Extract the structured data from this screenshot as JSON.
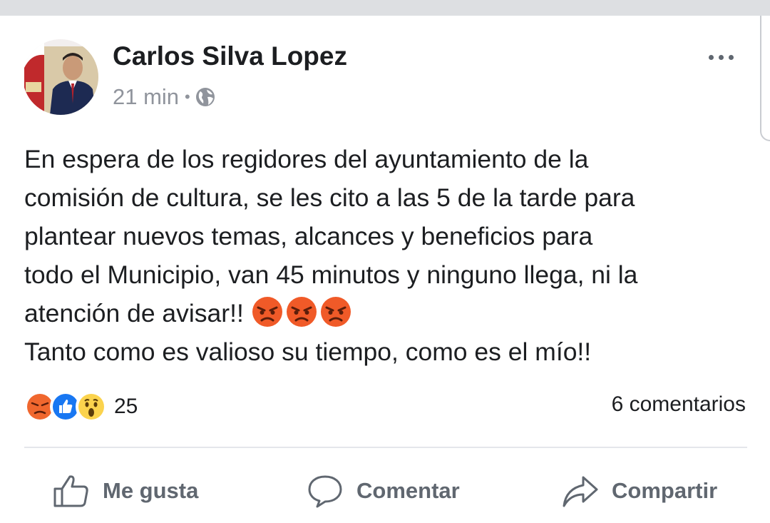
{
  "post": {
    "author": "Carlos Silva Lopez",
    "time": "21 min",
    "audience_icon": "globe-icon",
    "text_lines": [
      "En espera de los regidores del ayuntamiento de la",
      "comisión de cultura, se les cito a las 5 de la tarde para",
      "plantear nuevos temas, alcances y  beneficios para",
      "todo el Municipio, van 45 minutos y ninguno llega, ni la",
      "atención de avisar!!",
      "Tanto como es valioso su tiempo, como es el mío!!"
    ],
    "trailing_emojis": [
      "angry-face",
      "angry-face",
      "angry-face"
    ]
  },
  "stats": {
    "reaction_icons": [
      "angry-reaction-icon",
      "like-reaction-icon",
      "wow-reaction-icon"
    ],
    "reaction_count": "25",
    "comments": "6 comentarios"
  },
  "actions": {
    "like": "Me gusta",
    "comment": "Comentar",
    "share": "Compartir"
  },
  "colors": {
    "text": "#1c1e21",
    "meta": "#90949c",
    "action": "#606770",
    "like_blue": "#1877f2",
    "angry_orange": "#f05a28",
    "wow_yellow": "#fbd34d"
  }
}
